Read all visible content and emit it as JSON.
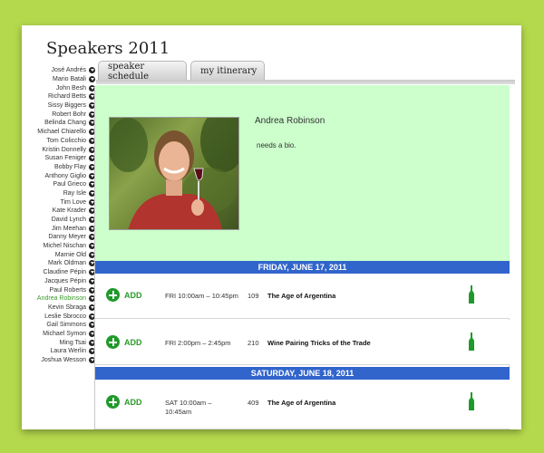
{
  "page": {
    "title": "Speakers 2011"
  },
  "speakers": [
    "José Andrés",
    "Mario Batali",
    "John Besh",
    "Richard Betts",
    "Sissy Biggers",
    "Robert Bohr",
    "Belinda Chang",
    "Michael Chiarello",
    "Tom Colicchio",
    "Kristin Donnelly",
    "Susan Feniger",
    "Bobby Flay",
    "Anthony Giglio",
    "Paul Grieco",
    "Ray Isle",
    "Tim Love",
    "Kate Krader",
    "David Lynch",
    "Jim Meehan",
    "Danny Meyer",
    "Michel Nischan",
    "Marnie Old",
    "Mark Oldman",
    "Claudine Pépin",
    "Jacques Pépin",
    "Paul Roberts",
    "Andrea Robinson",
    "Kevin Sbraga",
    "Leslie Sbrocco",
    "Gail Simmons",
    "Michael Symon",
    "Ming Tsai",
    "Laura Werlin",
    "Joshua Wesson"
  ],
  "active_speaker": "Andrea Robinson",
  "tabs": {
    "schedule": "speaker schedule",
    "itinerary": "my itinerary"
  },
  "bio": {
    "name": "Andrea Robinson",
    "text": "needs a bio."
  },
  "days": [
    {
      "label": "FRIDAY, JUNE 17, 2011"
    },
    {
      "label": "SATURDAY, JUNE 18, 2011"
    }
  ],
  "sessions": [
    {
      "add": "ADD",
      "time": "FRI 10:00am – 10:45pm",
      "room": "109",
      "title": "The Age of Argentina"
    },
    {
      "add": "ADD",
      "time": "FRI 2:00pm – 2:45pm",
      "room": "210",
      "title": "Wine Pairing Tricks of the Trade"
    },
    {
      "add": "ADD",
      "time": "SAT 10:00am – 10:45am",
      "room": "409",
      "title": "The Age of Argentina"
    }
  ],
  "colors": {
    "background": "#b5d94d",
    "bio_panel": "#ccffcc",
    "day_header": "#3165cc",
    "add_green": "#1f9a2a",
    "active_link": "#3a9a2a"
  },
  "icons": {
    "sidebar_arrow": "chevron-down-circle-icon",
    "add": "plus-circle-icon",
    "session": "wine-bottle-icon"
  }
}
